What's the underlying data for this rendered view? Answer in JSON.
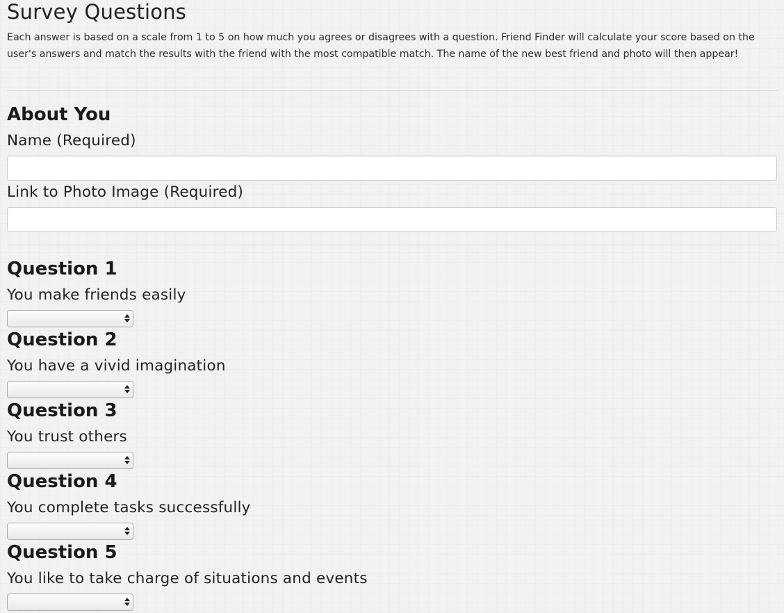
{
  "header": {
    "title": "Survey Questions",
    "intro": "Each answer is based on a scale from 1 to 5 on how much you agrees or disagrees with a question. Friend Finder will calculate your score based on the user's answers and match the results with the friend with the most compatible match. The name of the new best friend and photo will then appear!"
  },
  "about": {
    "heading": "About You",
    "name_label": "Name (Required)",
    "name_value": "",
    "photo_label": "Link to Photo Image (Required)",
    "photo_value": ""
  },
  "questions": [
    {
      "heading": "Question 1",
      "text": "You make friends easily",
      "selected": ""
    },
    {
      "heading": "Question 2",
      "text": "You have a vivid imagination",
      "selected": ""
    },
    {
      "heading": "Question 3",
      "text": "You trust others",
      "selected": ""
    },
    {
      "heading": "Question 4",
      "text": "You complete tasks successfully",
      "selected": ""
    },
    {
      "heading": "Question 5",
      "text": "You like to take charge of situations and events",
      "selected": ""
    }
  ],
  "icons": {
    "select_arrow": "up-down-arrows-icon"
  }
}
